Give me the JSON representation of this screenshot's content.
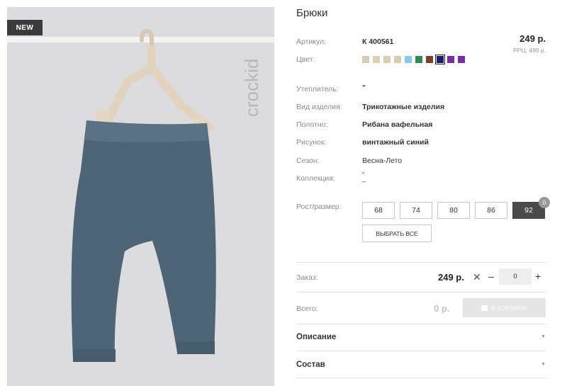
{
  "product": {
    "badge": "NEW",
    "brand_text": "crockid",
    "title": "Брюки",
    "price": "249 р.",
    "rrp": "РРЦ: 499 р."
  },
  "attributes": {
    "article_label": "Артикул:",
    "article_value": "К 400561",
    "color_label": "Цвет:",
    "insulation_label": "Утеплитель:",
    "insulation_value": "\"",
    "type_label": "Вид изделия:",
    "type_value": "Трикотажные изделия",
    "fabric_label": "Полотно:",
    "fabric_value": "Рибана вафельная",
    "pattern_label": "Рисунок:",
    "pattern_value": "винтажный синий",
    "season_label": "Сезон:",
    "season_value": "Весна-Лето",
    "collection_label": "Коллекция:",
    "collection_value": "\"\n–"
  },
  "colors": [
    "#d9ccb5",
    "#ddd0b9",
    "#dacdb4",
    "#d8ccb2",
    "#8ec8ea",
    "#2e8b57",
    "#7b3f2b",
    "#1a1a6e",
    "#7b2aa8",
    "#7b2aa8"
  ],
  "selected_color_index": 7,
  "sizes": {
    "label": "Рост/размер:",
    "items": [
      "68",
      "74",
      "80",
      "86",
      "92"
    ],
    "active_index": 4,
    "counter": "0",
    "select_all": "ВЫБРАТЬ ВСЕ"
  },
  "order": {
    "label": "Заказ:",
    "price": "249 р.",
    "times": "✕",
    "minus": "–",
    "qty": "0",
    "plus": "+"
  },
  "total": {
    "label": "Всего:",
    "value": "0 р.",
    "cart_button": "В КОРЗИНУ"
  },
  "accordion": {
    "description": "Описание",
    "composition": "Состав",
    "arrow": "▼"
  }
}
